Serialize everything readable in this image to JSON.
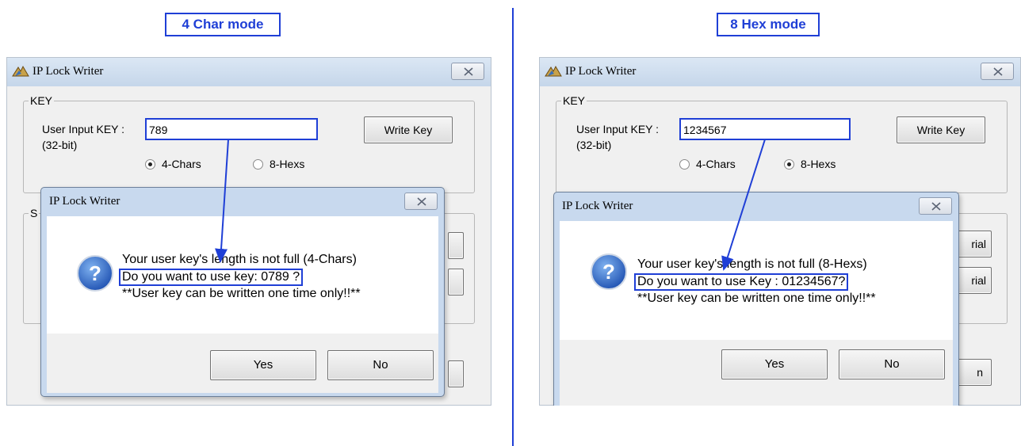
{
  "left_panel": {
    "mode_label": "4 Char mode",
    "window_title": "IP Lock Writer",
    "group_key_label": "KEY",
    "group_s_label": "S",
    "user_input_label": "User Input KEY :",
    "bit_label": "(32-bit)",
    "key_value": "789",
    "write_key_button": "Write Key",
    "radio_4chars": "4-Chars",
    "radio_8hexs": "8-Hexs",
    "selected_mode": "4-Chars",
    "dialog": {
      "title": "IP Lock Writer",
      "line1": "Your user key's length is not full (4-Chars)",
      "line2": "Do you want to use key: 0789 ?",
      "line3": "**User key can be written one time only!!**",
      "yes_button": "Yes",
      "no_button": "No"
    }
  },
  "right_panel": {
    "mode_label": "8 Hex mode",
    "window_title": "IP Lock Writer",
    "group_key_label": "KEY",
    "user_input_label": "User Input KEY :",
    "bit_label": "(32-bit)",
    "key_value": "1234567",
    "write_key_button": "Write Key",
    "radio_4chars": "4-Chars",
    "radio_8hexs": "8-Hexs",
    "selected_mode": "8-Hexs",
    "partial_button_1": "rial",
    "partial_button_2": "rial",
    "partial_button_3": "n",
    "dialog": {
      "title": "IP Lock Writer",
      "line1": "Your user key's length is not full (8-Hexs)",
      "line2": "Do you want to use Key : 01234567?",
      "line3": "**User key can be written one time only!!**",
      "yes_button": "Yes",
      "no_button": "No"
    }
  },
  "colors": {
    "annotation_blue": "#1f3fd6",
    "window_bg": "#f0f0f0",
    "titlebar": "#c5d6ea"
  },
  "icons": {
    "app_icon": "ip-lock-writer-icon",
    "dialog_icon": "question-icon",
    "close_icon": "close-icon"
  }
}
